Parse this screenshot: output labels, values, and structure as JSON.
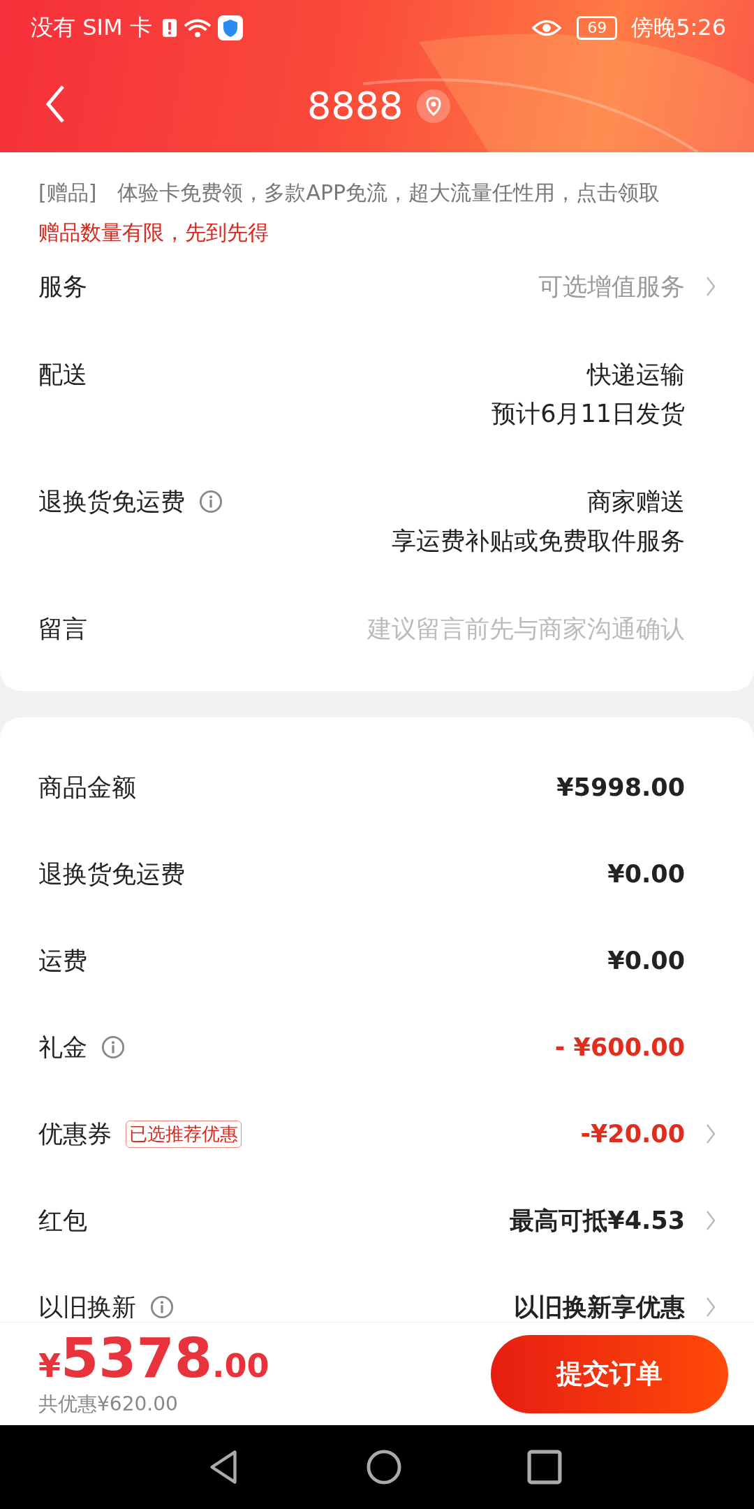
{
  "status_bar": {
    "carrier": "没有 SIM 卡",
    "battery": "69",
    "time": "傍晚5:26"
  },
  "header": {
    "title": "8888"
  },
  "gift_notes": [
    {
      "tag": "[赠品]",
      "text": "体验卡免费领，多款APP免流，超大流量任性用，点击领取"
    }
  ],
  "gift_notice": "赠品数量有限，先到先得",
  "options": [
    {
      "label": "服务",
      "kind": "text",
      "muted": true,
      "info": false,
      "chevron": true,
      "lines": [
        "可选增值服务"
      ]
    },
    {
      "label": "配送",
      "kind": "text",
      "muted": false,
      "info": false,
      "chevron": false,
      "lines": [
        "快递运输",
        "预计6月11日发货"
      ]
    },
    {
      "label": "退换货免运费",
      "kind": "text",
      "muted": false,
      "info": true,
      "chevron": false,
      "lines": [
        "商家赠送",
        "享运费补贴或免费取件服务"
      ]
    },
    {
      "label": "留言",
      "kind": "field",
      "info": false,
      "chevron": false,
      "placeholder": "建议留言前先与商家沟通确认"
    }
  ],
  "costs": [
    {
      "label": "商品金额",
      "value": "¥5998.00",
      "discount": false,
      "info": false,
      "chevron": false
    },
    {
      "label": "退换货免运费",
      "value": "¥0.00",
      "discount": false,
      "info": false,
      "chevron": false
    },
    {
      "label": "运费",
      "value": "¥0.00",
      "discount": false,
      "info": false,
      "chevron": false
    },
    {
      "label": "礼金",
      "value": "- ¥600.00",
      "discount": true,
      "info": true,
      "chevron": false
    },
    {
      "label": "优惠券",
      "badge": "已选推荐优惠",
      "value": "-¥20.00",
      "discount": true,
      "info": false,
      "chevron": true
    },
    {
      "label": "红包",
      "value": "最高可抵¥4.53",
      "discount": false,
      "info": false,
      "chevron": true
    },
    {
      "label": "以旧换新",
      "value": "以旧换新享优惠",
      "discount": false,
      "info": true,
      "chevron": true
    }
  ],
  "total": {
    "currency": "¥",
    "integer": "5378",
    "decimal": ".00",
    "saving": "共优惠¥620.00"
  },
  "submit": "提交订单"
}
